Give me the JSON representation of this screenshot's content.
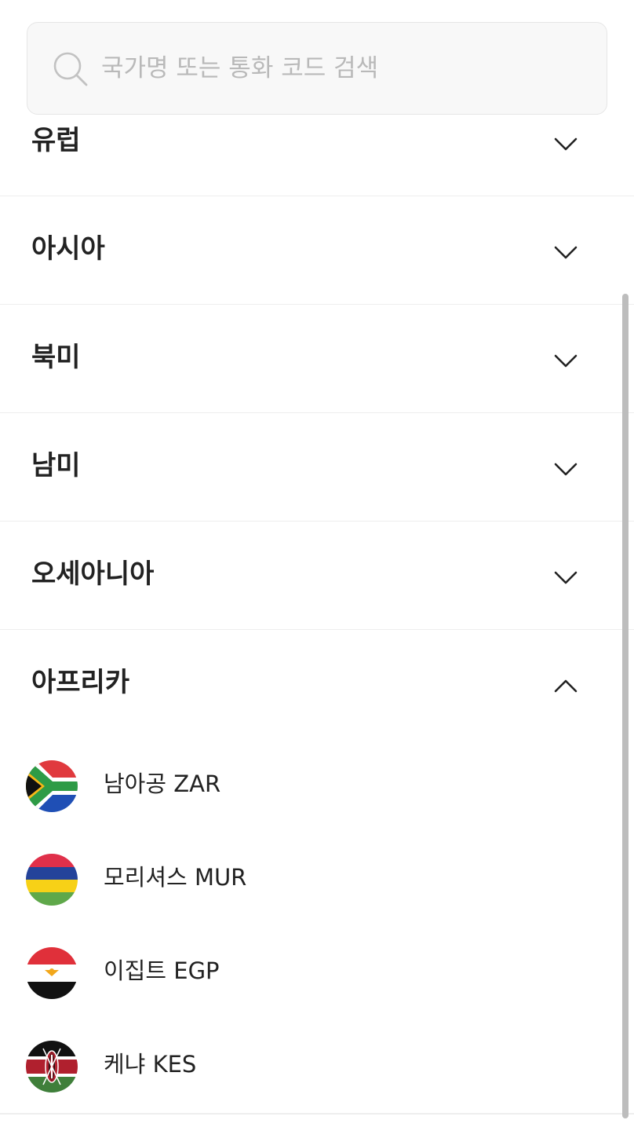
{
  "search": {
    "placeholder": "국가명 또는 통화 코드 검색",
    "value": ""
  },
  "regions": [
    {
      "label": "유럽",
      "expanded": false
    },
    {
      "label": "아시아",
      "expanded": false
    },
    {
      "label": "북미",
      "expanded": false
    },
    {
      "label": "남미",
      "expanded": false
    },
    {
      "label": "오세아니아",
      "expanded": false
    },
    {
      "label": "아프리카",
      "expanded": true
    }
  ],
  "africa_currencies": [
    {
      "label": "남아공 ZAR",
      "flag": "south-africa-flag"
    },
    {
      "label": "모리셔스 MUR",
      "flag": "mauritius-flag"
    },
    {
      "label": "이집트 EGP",
      "flag": "egypt-flag"
    },
    {
      "label": "케냐 KES",
      "flag": "kenya-flag"
    }
  ],
  "colors": {
    "divider": "#eeeeee",
    "search_bg": "#f8f8f8",
    "placeholder": "#b9b9b9",
    "text": "#222222"
  }
}
